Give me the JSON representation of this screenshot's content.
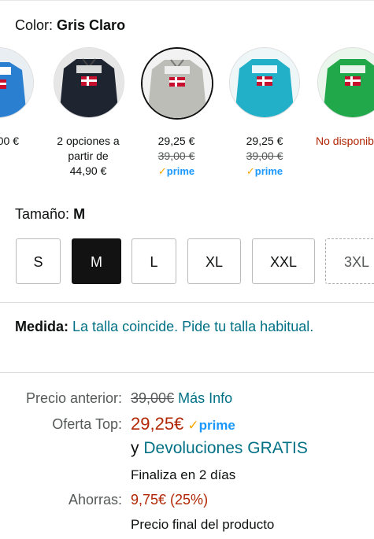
{
  "color": {
    "label": "Color:",
    "value": "Gris Claro"
  },
  "swatches": [
    {
      "price": "00 €",
      "color": "#2a7fd0"
    },
    {
      "line1": "2 opciones a",
      "line2": "partir de",
      "line3": "44,90 €",
      "color": "#1e2430"
    },
    {
      "price": "29,25 €",
      "old": "39,00 €",
      "prime": "prime",
      "color": "#bdbdb8"
    },
    {
      "price": "29,25 €",
      "old": "39,00 €",
      "prime": "prime",
      "color": "#22b0c8"
    },
    {
      "unavailable": "No disponib",
      "color": "#21a84a"
    }
  ],
  "size": {
    "label": "Tamaño:",
    "value": "M",
    "options": [
      "S",
      "M",
      "L",
      "XL",
      "XXL",
      "3XL"
    ]
  },
  "fit": {
    "label": "Medida:",
    "text": "La talla coincide. Pide tu talla habitual."
  },
  "pricing": {
    "previous_label": "Precio anterior:",
    "previous_value": "39,00€",
    "more_info": "Más Info",
    "offer_label": "Oferta Top:",
    "offer_value": "29,25€",
    "prime": "prime",
    "returns_prefix": "y",
    "returns_link": "Devoluciones GRATIS",
    "ends": "Finaliza en 2 días",
    "savings_label": "Ahorras:",
    "savings_value": "9,75€ (25%)",
    "final_note": "Precio final del producto"
  }
}
